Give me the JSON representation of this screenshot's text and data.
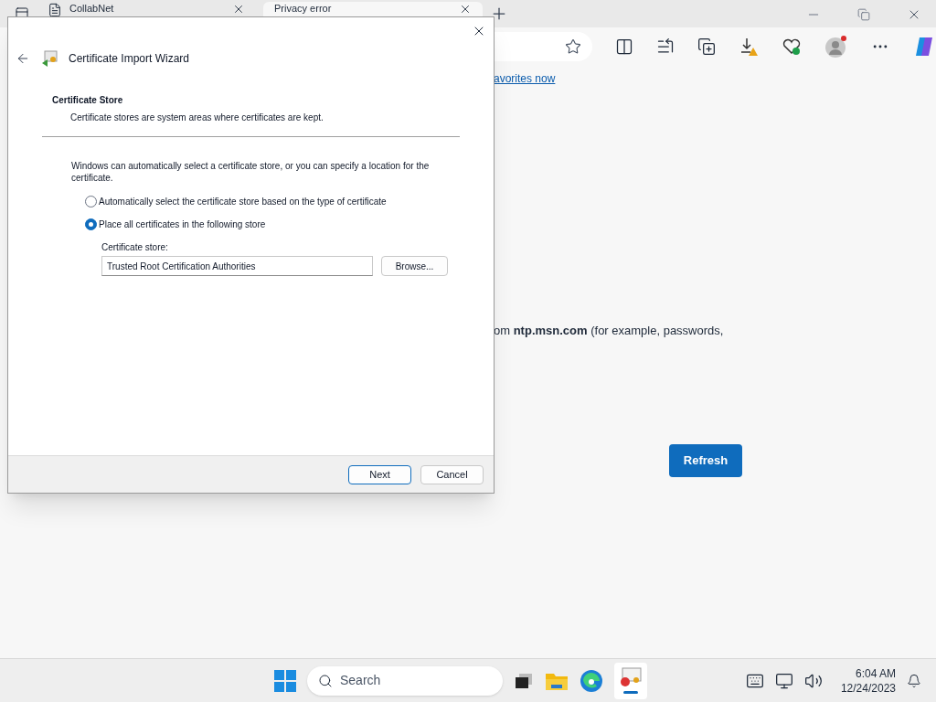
{
  "browser": {
    "tabs": [
      {
        "title": "CollabNet",
        "selected": false
      },
      {
        "title": "Privacy error",
        "selected": true
      }
    ],
    "favorites_bar": {
      "link": "avorites now"
    },
    "content": {
      "text": "om **ntp.msn.com** (for example, passwords,",
      "button": "Refresh"
    }
  },
  "dialog": {
    "title": "Certificate Import Wizard",
    "heading": "Certificate Store",
    "subheading": "Certificate stores are system areas where certificates are kept.",
    "description": "Windows can automatically select a certificate store, or you can specify a location for the certificate.",
    "options": [
      {
        "label": "Automatically select the certificate store based on the type of certificate",
        "selected": false
      },
      {
        "label": "Place all certificates in the following store",
        "selected": true
      }
    ],
    "store_label": "Certificate store:",
    "store_value": "Trusted Root Certification Authorities",
    "browse": "Browse...",
    "buttons": [
      {
        "label": "Next",
        "primary": true
      },
      {
        "label": "Cancel",
        "primary": false
      }
    ]
  },
  "taskbar": {
    "search_placeholder": "Search",
    "time": "6:04 AM",
    "date": "12/24/2023"
  }
}
